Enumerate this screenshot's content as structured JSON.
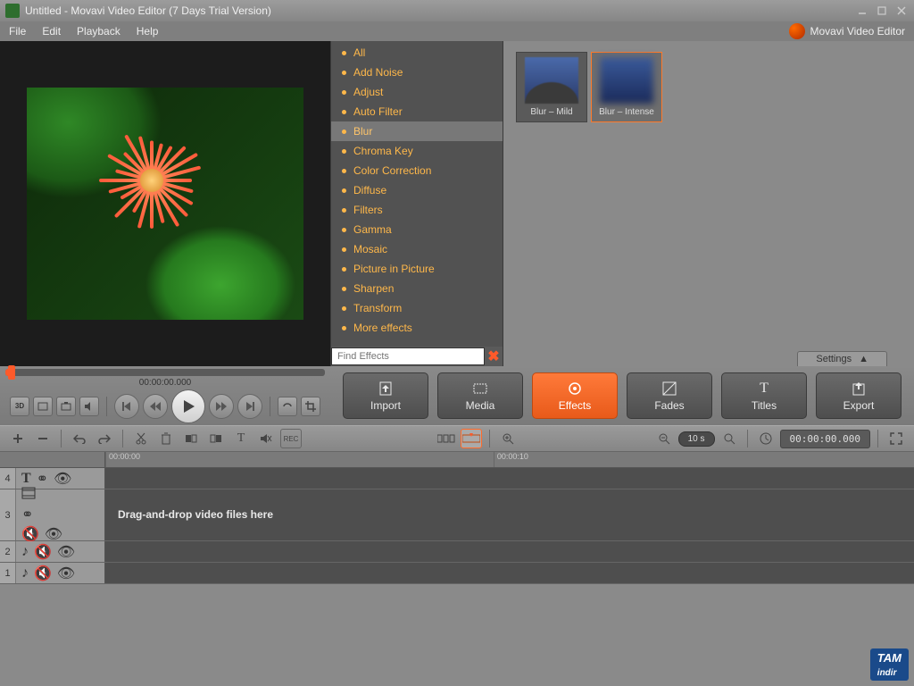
{
  "window": {
    "title": "Untitled - Movavi Video Editor (7 Days Trial Version)"
  },
  "menu": {
    "file": "File",
    "edit": "Edit",
    "playback": "Playback",
    "help": "Help"
  },
  "brand": {
    "label": "Movavi Video Editor"
  },
  "effects": {
    "items": [
      {
        "label": "All",
        "sel": false
      },
      {
        "label": "Add Noise",
        "sel": false
      },
      {
        "label": "Adjust",
        "sel": false
      },
      {
        "label": "Auto Filter",
        "sel": false
      },
      {
        "label": "Blur",
        "sel": true
      },
      {
        "label": "Chroma Key",
        "sel": false
      },
      {
        "label": "Color Correction",
        "sel": false
      },
      {
        "label": "Diffuse",
        "sel": false
      },
      {
        "label": "Filters",
        "sel": false
      },
      {
        "label": "Gamma",
        "sel": false
      },
      {
        "label": "Mosaic",
        "sel": false
      },
      {
        "label": "Picture in Picture",
        "sel": false
      },
      {
        "label": "Sharpen",
        "sel": false
      },
      {
        "label": "Transform",
        "sel": false
      },
      {
        "label": "More effects",
        "sel": false
      }
    ],
    "find_placeholder": "Find Effects",
    "thumbs": [
      {
        "label": "Blur – Mild",
        "sel": false,
        "cls": "mild"
      },
      {
        "label": "Blur – Intense",
        "sel": true,
        "cls": "intense"
      }
    ],
    "settings_label": "Settings"
  },
  "playback": {
    "timecode": "00:00:00.000",
    "progress_pct": 2
  },
  "tabs": {
    "import": "Import",
    "media": "Media",
    "effects": "Effects",
    "fades": "Fades",
    "titles": "Titles",
    "export": "Export",
    "active": "effects"
  },
  "timeline": {
    "zoom_label": "10 s",
    "clock": "00:00:00.000",
    "ruler": [
      {
        "pos": 0,
        "label": "00:00:00"
      },
      {
        "pos": 48,
        "label": "00:00:10"
      }
    ],
    "tracks": [
      {
        "num": "4",
        "type": "title",
        "size": "sm"
      },
      {
        "num": "3",
        "type": "video",
        "size": "lg",
        "hint": "Drag-and-drop\nvideo files here"
      },
      {
        "num": "2",
        "type": "audio",
        "size": "sm"
      },
      {
        "num": "1",
        "type": "audio",
        "size": "sm"
      }
    ]
  },
  "watermark": "TAM\nindir"
}
